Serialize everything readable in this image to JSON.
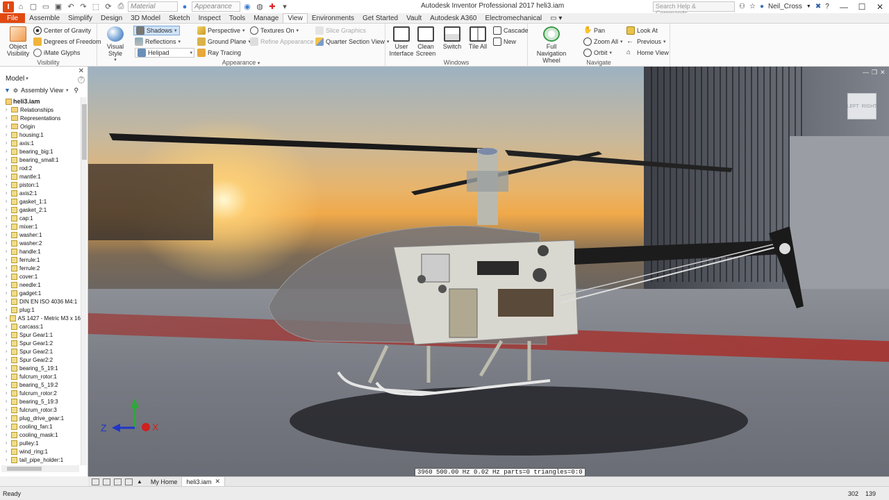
{
  "titlebar": {
    "title": "Autodesk Inventor Professional 2017    heli3.iam",
    "material_combo": "Material",
    "appearance_combo": "Appearance",
    "help_search_placeholder": "Search Help & Commands...",
    "user_name": "Neil_Cross"
  },
  "ribbon_tabs": [
    "Assemble",
    "Simplify",
    "Design",
    "3D Model",
    "Sketch",
    "Inspect",
    "Tools",
    "Manage",
    "View",
    "Environments",
    "Get Started",
    "Vault",
    "Autodesk A360",
    "Electromechanical"
  ],
  "file_tab": "File",
  "active_tab": "View",
  "ribbon": {
    "visibility": {
      "label": "Visibility",
      "object_visibility": "Object Visibility",
      "center_of_gravity": "Center of Gravity",
      "degrees_of_freedom": "Degrees of Freedom",
      "imate_glyphs": "iMate Glyphs"
    },
    "appearance": {
      "label": "Appearance",
      "visual_style": "Visual Style",
      "shadows": "Shadows",
      "reflections": "Reflections",
      "helipad": "Helipad",
      "perspective": "Perspective",
      "ground_plane": "Ground Plane",
      "ray_tracing": "Ray Tracing",
      "textures_on": "Textures On",
      "refine_appearance": "Refine Appearance",
      "slice_graphics": "Slice Graphics",
      "quarter_section_view": "Quarter Section View"
    },
    "windows": {
      "label": "Windows",
      "user_interface": "User Interface",
      "clean_screen": "Clean Screen",
      "switch": "Switch",
      "tile_all": "Tile All",
      "cascade": "Cascade",
      "new": "New"
    },
    "navigate": {
      "label": "Navigate",
      "full_navigation_wheel": "Full Navigation Wheel",
      "pan": "Pan",
      "zoom_all": "Zoom All",
      "orbit": "Orbit",
      "look_at": "Look At",
      "previous": "Previous",
      "home_view": "Home View"
    }
  },
  "browser": {
    "title": "Model",
    "view": "Assembly View",
    "root": "heli3.iam",
    "items": [
      {
        "label": "Relationships",
        "kind": "folder"
      },
      {
        "label": "Representations",
        "kind": "folder"
      },
      {
        "label": "Origin",
        "kind": "folder"
      },
      {
        "label": "housing:1",
        "kind": "part"
      },
      {
        "label": "axis:1",
        "kind": "part"
      },
      {
        "label": "bearing_big:1",
        "kind": "part"
      },
      {
        "label": "bearing_small:1",
        "kind": "part"
      },
      {
        "label": "rod:2",
        "kind": "part"
      },
      {
        "label": "mantle:1",
        "kind": "part"
      },
      {
        "label": "piston:1",
        "kind": "part"
      },
      {
        "label": "axis2:1",
        "kind": "part"
      },
      {
        "label": "gasket_1:1",
        "kind": "part"
      },
      {
        "label": "gasket_2:1",
        "kind": "part"
      },
      {
        "label": "cap:1",
        "kind": "part"
      },
      {
        "label": "mixer:1",
        "kind": "part"
      },
      {
        "label": "washer:1",
        "kind": "part"
      },
      {
        "label": "washer:2",
        "kind": "part"
      },
      {
        "label": "handle:1",
        "kind": "part"
      },
      {
        "label": "ferrule:1",
        "kind": "part"
      },
      {
        "label": "ferrule:2",
        "kind": "part"
      },
      {
        "label": "cover:1",
        "kind": "part"
      },
      {
        "label": "needle:1",
        "kind": "part"
      },
      {
        "label": "gadget:1",
        "kind": "part"
      },
      {
        "label": "DIN EN ISO 4036 M4:1",
        "kind": "part"
      },
      {
        "label": "plug:1",
        "kind": "part"
      },
      {
        "label": "AS 1427 - Metric M3 x 16",
        "kind": "part"
      },
      {
        "label": "carcass:1",
        "kind": "part"
      },
      {
        "label": "Spur Gear1:1",
        "kind": "part"
      },
      {
        "label": "Spur Gear1:2",
        "kind": "part"
      },
      {
        "label": "Spur Gear2:1",
        "kind": "part"
      },
      {
        "label": "Spur Gear2:2",
        "kind": "part"
      },
      {
        "label": "bearing_5_19:1",
        "kind": "part"
      },
      {
        "label": "fulcrum_rotor:1",
        "kind": "part"
      },
      {
        "label": "bearing_5_19:2",
        "kind": "part"
      },
      {
        "label": "fulcrum_rotor:2",
        "kind": "part"
      },
      {
        "label": "bearing_5_19:3",
        "kind": "part"
      },
      {
        "label": "fulcrum_rotor:3",
        "kind": "part"
      },
      {
        "label": "plug_drive_gear:1",
        "kind": "part"
      },
      {
        "label": "cooling_fan:1",
        "kind": "part"
      },
      {
        "label": "cooling_mask:1",
        "kind": "part"
      },
      {
        "label": "pulley:1",
        "kind": "part"
      },
      {
        "label": "wind_ring:1",
        "kind": "part"
      },
      {
        "label": "tail_pipe_holder:1",
        "kind": "part"
      }
    ]
  },
  "viewport": {
    "perf_readout": "3960 500.00 Hz   0.02 Hz  parts=0 triangles=0:0",
    "viewcube_left": "LEFT",
    "viewcube_right": "RIGHT",
    "triad_x": "X",
    "triad_z": "Z"
  },
  "doc_tabs": {
    "home": "My Home",
    "active": "heli3.iam"
  },
  "status": {
    "text": "Ready",
    "num1": "302",
    "num2": "139"
  },
  "colors": {
    "file_tab": "#e04a12",
    "shadows_highlight": "#cfe3f7"
  }
}
